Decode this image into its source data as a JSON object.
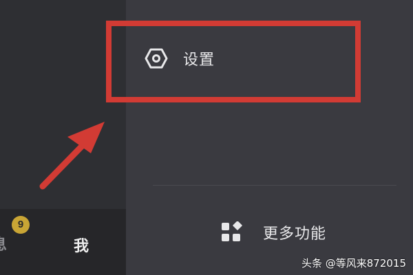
{
  "settings_menu": {
    "settings_label": "设置",
    "more_features_label": "更多功能",
    "settings_icon": "hexagon-gear-icon",
    "more_features_icon": "apps-grid-icon"
  },
  "tabbar": {
    "messages_partial_label": "息",
    "messages_badge_count": "9",
    "me_label": "我"
  },
  "annotation": {
    "highlight_color": "#d23b34",
    "arrow_color": "#d23b34"
  },
  "watermark": {
    "text": "头条 @等风来872015"
  },
  "colors": {
    "right_panel_bg": "#3a3a40",
    "left_panel_bg": "#2e2f33",
    "badge_bg": "#c9a535"
  }
}
